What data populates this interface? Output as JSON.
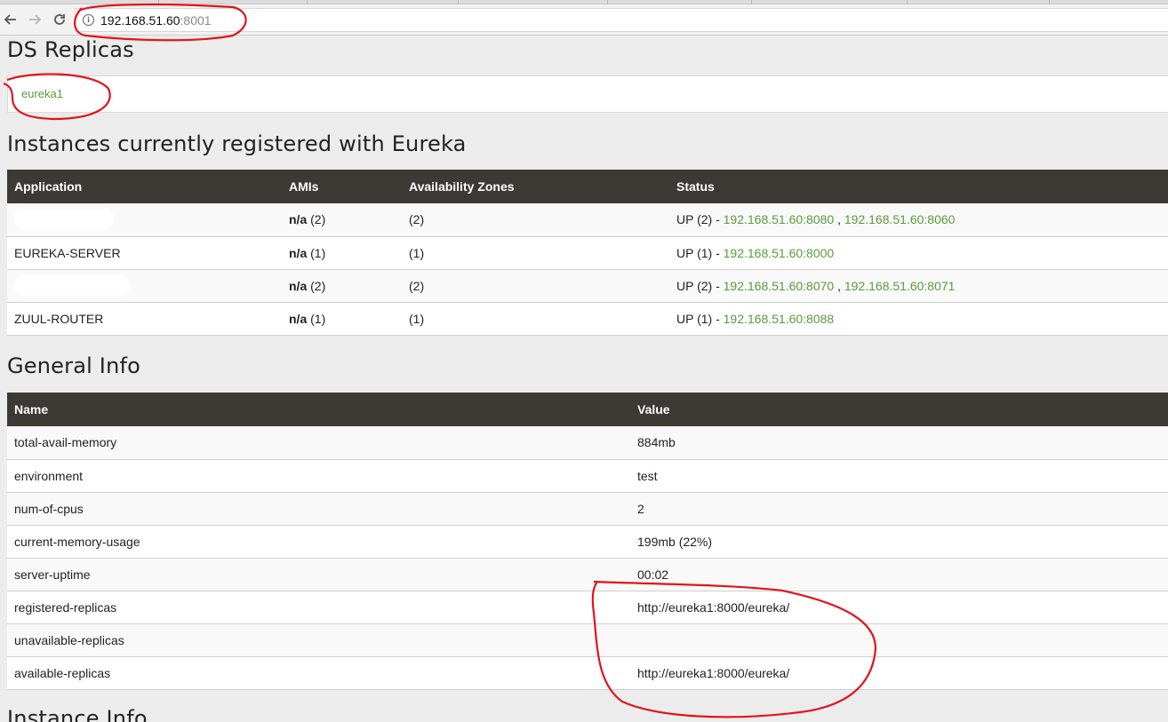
{
  "browser": {
    "url_host": "192.168.51.60",
    "url_port": ":8001",
    "icons": {
      "back": "arrow-left-icon",
      "forward": "arrow-right-icon",
      "reload": "reload-icon",
      "info": "info-icon"
    }
  },
  "replicas": {
    "title": "DS Replicas",
    "items": [
      "eureka1"
    ]
  },
  "instances": {
    "title": "Instances currently registered with Eureka",
    "headers": [
      "Application",
      "AMIs",
      "Availability Zones",
      "Status"
    ],
    "rows": [
      {
        "application": "",
        "amis_label": "n/a",
        "amis_count": "(2)",
        "zones": "(2)",
        "status_prefix": "UP (2) - ",
        "links": [
          "192.168.51.60:8080",
          "192.168.51.60:8060"
        ]
      },
      {
        "application": "EUREKA-SERVER",
        "amis_label": "n/a",
        "amis_count": "(1)",
        "zones": "(1)",
        "status_prefix": "UP (1) - ",
        "links": [
          "192.168.51.60:8000"
        ]
      },
      {
        "application": "",
        "amis_label": "n/a",
        "amis_count": "(2)",
        "zones": "(2)",
        "status_prefix": "UP (2) - ",
        "links": [
          "192.168.51.60:8070",
          "192.168.51.60:8071"
        ]
      },
      {
        "application": "ZUUL-ROUTER",
        "amis_label": "n/a",
        "amis_count": "(1)",
        "zones": "(1)",
        "status_prefix": "UP (1) - ",
        "links": [
          "192.168.51.60:8088"
        ]
      }
    ]
  },
  "general_info": {
    "title": "General Info",
    "headers": [
      "Name",
      "Value"
    ],
    "rows": [
      {
        "name": "total-avail-memory",
        "value": "884mb"
      },
      {
        "name": "environment",
        "value": "test"
      },
      {
        "name": "num-of-cpus",
        "value": "2"
      },
      {
        "name": "current-memory-usage",
        "value": "199mb (22%)"
      },
      {
        "name": "server-uptime",
        "value": "00:02"
      },
      {
        "name": "registered-replicas",
        "value": "http://eureka1:8000/eureka/"
      },
      {
        "name": "unavailable-replicas",
        "value": ""
      },
      {
        "name": "available-replicas",
        "value": "http://eureka1:8000/eureka/"
      }
    ]
  },
  "instance_info": {
    "title": "Instance Info"
  },
  "colors": {
    "header_bg": "#3c3a35",
    "link": "#5a9b3c",
    "annotation": "#e0141e",
    "page_bg": "#ececec"
  }
}
